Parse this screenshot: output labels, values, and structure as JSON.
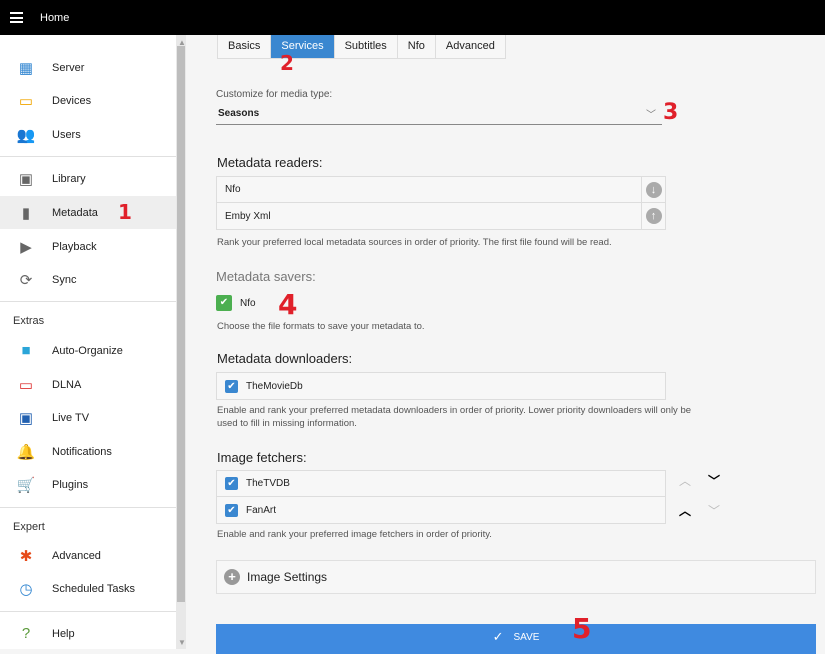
{
  "header": {
    "title": "Home",
    "menu_icon": "hamburger-icon"
  },
  "sidebar": {
    "items": [
      {
        "label": "Server",
        "icon": "dashboard-icon",
        "color": "#2f84d0"
      },
      {
        "label": "Devices",
        "icon": "tablet-icon",
        "color": "#f0a500"
      },
      {
        "label": "Users",
        "icon": "people-icon",
        "color": "#5a9a3a"
      },
      {
        "label": "Library",
        "icon": "video-library-icon",
        "color": "#666"
      },
      {
        "label": "Metadata",
        "icon": "file-icon",
        "color": "#666"
      },
      {
        "label": "Playback",
        "icon": "play-circle-icon",
        "color": "#666"
      },
      {
        "label": "Sync",
        "icon": "sync-icon",
        "color": "#666"
      },
      {
        "label": "Auto-Organize",
        "icon": "folder-icon",
        "color": "#2aa5d8"
      },
      {
        "label": "DLNA",
        "icon": "tv-icon",
        "color": "#d33"
      },
      {
        "label": "Live TV",
        "icon": "live-tv-icon",
        "color": "#2260b0"
      },
      {
        "label": "Notifications",
        "icon": "bell-icon",
        "color": "#c62828"
      },
      {
        "label": "Plugins",
        "icon": "cart-icon",
        "color": "#9c27b0"
      },
      {
        "label": "Advanced",
        "icon": "gear-icon",
        "color": "#e64a19"
      },
      {
        "label": "Scheduled Tasks",
        "icon": "clock-icon",
        "color": "#2f84d0"
      },
      {
        "label": "Help",
        "icon": "help-icon",
        "color": "#5a9a3a"
      }
    ],
    "sections": {
      "extras": "Extras",
      "expert": "Expert"
    }
  },
  "tabs": [
    "Basics",
    "Services",
    "Subtitles",
    "Nfo",
    "Advanced"
  ],
  "media_type": {
    "label": "Customize for media type:",
    "value": "Seasons"
  },
  "readers": {
    "title": "Metadata readers:",
    "items": [
      "Nfo",
      "Emby Xml"
    ],
    "help": "Rank your preferred local metadata sources in order of priority. The first file found will be read."
  },
  "savers": {
    "title": "Metadata savers:",
    "items": [
      "Nfo"
    ],
    "help": "Choose the file formats to save your metadata to."
  },
  "downloaders": {
    "title": "Metadata downloaders:",
    "items": [
      "TheMovieDb"
    ],
    "help": "Enable and rank your preferred metadata downloaders in order of priority. Lower priority downloaders will only be used to fill in missing information."
  },
  "fetchers": {
    "title": "Image fetchers:",
    "items": [
      "TheTVDB",
      "FanArt"
    ],
    "help": "Enable and rank your preferred image fetchers in order of priority."
  },
  "image_settings": "Image Settings",
  "save": "SAVE",
  "annotations": [
    "1",
    "2",
    "3",
    "4",
    "5"
  ]
}
